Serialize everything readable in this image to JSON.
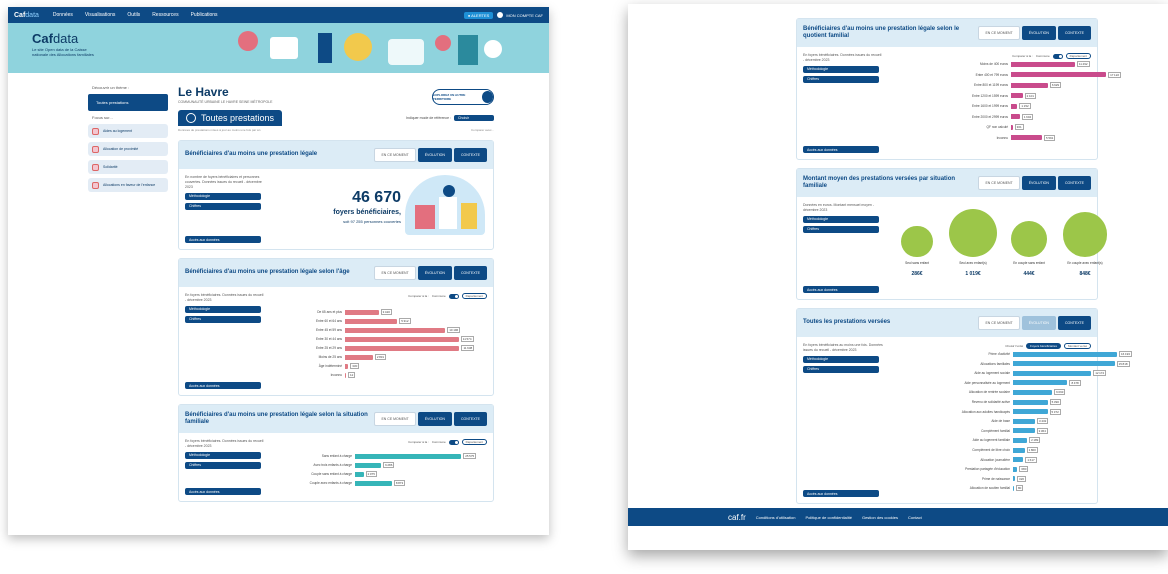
{
  "colors": {
    "nav": "#0d4a85",
    "hero": "#8fd3dd",
    "pink": "#c94b8c",
    "red": "#e07a84",
    "teal": "#36b5b8",
    "blue": "#3fa7d6",
    "green": "#9cc649"
  },
  "navbar": {
    "logo": "Caf",
    "logo_suffix": "data",
    "items": [
      "Données",
      "Visualisations",
      "Outils",
      "Ressources",
      "Publications"
    ],
    "action_label": "● ALERTES",
    "account_label": "MON COMPTE CAF"
  },
  "hero": {
    "brand": "Caf",
    "brand_suffix": "data",
    "tagline": "Le site Open data de la Caisse nationale des Allocations familiales"
  },
  "sidebar": {
    "heading": "Découvrir un thème :",
    "active": "Toutes prestations",
    "sub_heading": "Focus sur...",
    "items": [
      "Aides au logement",
      "Allocation de proximité",
      "Solidarité",
      "Allocations en faveur de l'enfance"
    ]
  },
  "main": {
    "title": "Le Havre",
    "subtitle": "COMMUNAUTÉ URBAINE LE HAVRE SEINE MÉTROPOLE",
    "explore_label": "EXPLOREZ UN AUTRE TERRITOIRE",
    "tab_label": "Toutes prestations",
    "filter_label": "Indiquer mode de référence :",
    "filter_value": "Choisir",
    "note_left": "Données de prestations mises à jour au moins une fois par an",
    "note_right": "Comparer avec..."
  },
  "views": {
    "now": "EN CE MOMENT",
    "evolution": "ÉVOLUTION",
    "context": "CONTEXTE"
  },
  "accordion": {
    "method": "Méthodologie",
    "download": "Chiffres",
    "dl_button": "Accès aux données"
  },
  "card1": {
    "title": "Bénéficiaires d'au moins une prestation légale",
    "meta": "En nombre de foyers bénéficiaires et personnes couvertes. Données issues du recueil - décembre 2023",
    "value": "46 670",
    "value_label": "foyers bénéficiaires,",
    "value_sub": "soit 97 255 personnes couvertes"
  },
  "card2": {
    "title": "Bénéficiaires d'au moins une prestation légale selon l'âge",
    "meta": "En foyers bénéficiaires. Données issues du recueil - décembre 2023",
    "legend": [
      "Comparer à la :",
      "Commune",
      "Département"
    ],
    "rows": [
      {
        "label": "De 65 ans et plus",
        "value": 3420
      },
      {
        "label": "Entre 60 et 64 ans",
        "value": 5312
      },
      {
        "label": "Entre 45 et 59 ans",
        "value": 10196
      },
      {
        "label": "Entre 30 et 44 ans",
        "value": 11574
      },
      {
        "label": "Entre 25 et 29 ans",
        "value": 11638
      },
      {
        "label": "Moins de 25 ans",
        "value": 2831
      },
      {
        "label": "Âge indéterminé",
        "value": 330
      },
      {
        "label": "Inconnu",
        "value": 12
      }
    ],
    "max": 12000
  },
  "card3": {
    "title": "Bénéficiaires d'au moins une prestation légale selon la situation familiale",
    "meta": "En foyers bénéficiaires. Données issues du recueil - décembre 2023",
    "legend": [
      "Comparer à la :",
      "Commune",
      "Département"
    ],
    "rows": [
      {
        "label": "Sans enfant à charge",
        "value": 25575
      },
      {
        "label": "Avec trois enfants à charge",
        "value": 6286
      },
      {
        "label": "Couple sans enfant à charge",
        "value": 2075
      },
      {
        "label": "Couple avec enfants à charge",
        "value": 8873
      }
    ],
    "max": 26000
  },
  "card4": {
    "title": "Bénéficiaires d'au moins une prestation légale selon le quotient familial",
    "meta": "En foyers bénéficiaires. Données issues du recueil - décembre 2023",
    "legend": [
      "Comparer à la :",
      "Commune",
      "Département"
    ],
    "rows": [
      {
        "label": "Moins de 400 euros",
        "value": 11492
      },
      {
        "label": "Entre 400 et 799 euros",
        "value": 17122
      },
      {
        "label": "Entre 800 et 1199 euros",
        "value": 6629
      },
      {
        "label": "Entre 1200 et 1599 euros",
        "value": 2101
      },
      {
        "label": "Entre 1600 et 1999 euros",
        "value": 1152
      },
      {
        "label": "Entre 2000 et 2999 euros",
        "value": 1604
      },
      {
        "label": "QF non calculé",
        "value": 301
      },
      {
        "label": "Inconnu",
        "value": 5591
      }
    ],
    "max": 18000
  },
  "card5": {
    "title": "Montant moyen des prestations versées par situation familiale",
    "meta": "Données en euros. Montant mensuel moyen - décembre 2023",
    "items": [
      {
        "label": "Seul sans enfant",
        "value": "286€",
        "amount": 286
      },
      {
        "label": "Seul avec enfant(s)",
        "value": "1 019€",
        "amount": 1019
      },
      {
        "label": "En couple sans enfant",
        "value": "444€",
        "amount": 444
      },
      {
        "label": "En couple avec enfant(s)",
        "value": "848€",
        "amount": 848
      }
    ]
  },
  "card6": {
    "title": "Toutes les prestations versées",
    "meta": "En foyers bénéficiaires au moins une fois. Données issues du recueil - décembre 2023",
    "chips": [
      "Choisir l'unité",
      "Foyers bénéficiaires",
      "Montant versé"
    ],
    "rows": [
      {
        "label": "Prime d'activité",
        "value": 16193
      },
      {
        "label": "Allocations familiales",
        "value": 15818
      },
      {
        "label": "Aide au logement sociale",
        "value": 12172
      },
      {
        "label": "Aide personnalisée au logement",
        "value": 8478
      },
      {
        "label": "Allocation de rentrée scolaire",
        "value": 6093
      },
      {
        "label": "Revenu de solidarité active",
        "value": 5390
      },
      {
        "label": "Allocation aux adultes handicapés",
        "value": 5372
      },
      {
        "label": "Aide de base",
        "value": 3432
      },
      {
        "label": "Complément familial",
        "value": 3364
      },
      {
        "label": "Aide au logement familiale",
        "value": 2189
      },
      {
        "label": "Complément de libre choix",
        "value": 1800
      },
      {
        "label": "Allocation journalière",
        "value": 1617
      },
      {
        "label": "Prestation partagée d'éducation",
        "value": 680
      },
      {
        "label": "Prime de naissance",
        "value": 320
      },
      {
        "label": "Allocation de soutien familial",
        "value": 80
      }
    ],
    "max": 16500
  },
  "footer": {
    "logo": "caf.fr",
    "links": [
      "Conditions d'utilisation",
      "Politique de confidentialité",
      "Gestion des cookies",
      "Contact"
    ]
  }
}
